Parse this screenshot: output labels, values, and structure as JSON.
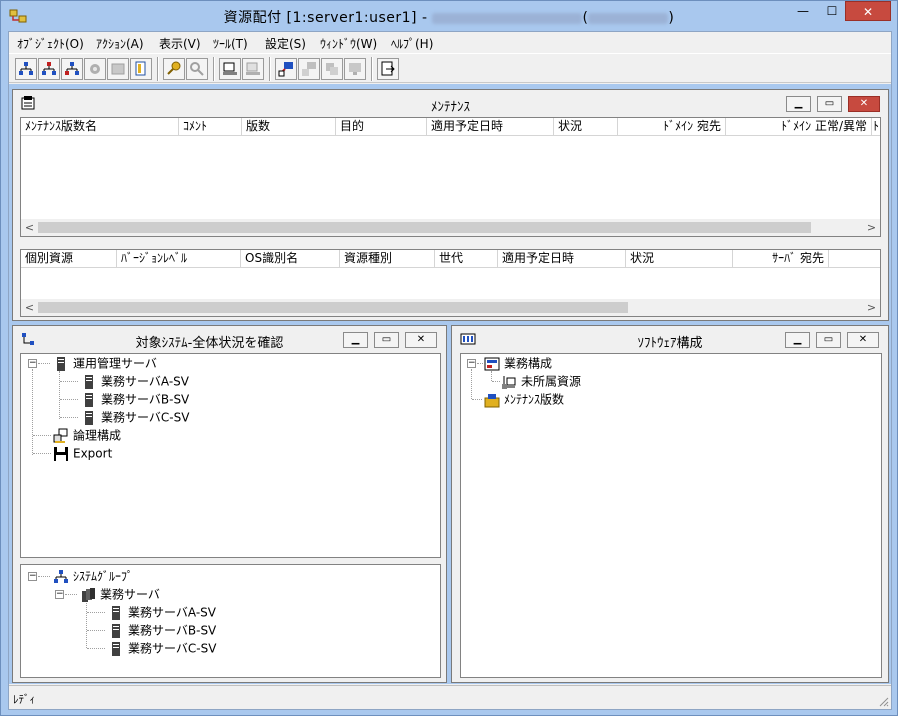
{
  "window": {
    "title_prefix": "資源配付 [1:server1:user1] - ",
    "title_redacted_open": "(",
    "title_redacted_close": ")",
    "caption_min": "—",
    "caption_max": "☐",
    "caption_close": "✕"
  },
  "menu": [
    {
      "label": "ｵﾌﾞｼﾞｪｸﾄ(O)"
    },
    {
      "label": "ｱｸｼｮﾝ(A)"
    },
    {
      "label": "表示(V)"
    },
    {
      "label": "ﾂｰﾙ(T)"
    },
    {
      "label": "設定(S)"
    },
    {
      "label": "ｳｨﾝﾄﾞｳ(W)"
    },
    {
      "label": "ﾍﾙﾌﾟ(H)"
    }
  ],
  "maintenance": {
    "title": "ﾒﾝﾃﾅﾝｽ",
    "columns": [
      "ﾒﾝﾃﾅﾝｽ版数名",
      "ｺﾒﾝﾄ",
      "版数",
      "目的",
      "適用予定日時",
      "状況",
      "ﾄﾞﾒｲﾝ 宛先",
      "ﾄﾞﾒｲﾝ 正常/異常",
      "ﾄ"
    ],
    "columns2": [
      "個別資源",
      "ﾊﾞｰｼﾞｮﾝﾚﾍﾞﾙ",
      "OS識別名",
      "資源種別",
      "世代",
      "適用予定日時",
      "状況",
      "ｻｰﾊﾞ 宛先"
    ]
  },
  "system_panel": {
    "title": "対象ｼｽﾃﾑ-全体状況を確認",
    "tree1": [
      {
        "label": "運用管理サーバ"
      },
      {
        "label": "業務サーバA-SV"
      },
      {
        "label": "業務サーバB-SV"
      },
      {
        "label": "業務サーバC-SV"
      },
      {
        "label": "論理構成"
      },
      {
        "label": "Export"
      }
    ],
    "tree2": [
      {
        "label": "ｼｽﾃﾑｸﾞﾙｰﾌﾟ"
      },
      {
        "label": "業務サーバ"
      },
      {
        "label": "業務サーバA-SV"
      },
      {
        "label": "業務サーバB-SV"
      },
      {
        "label": "業務サーバC-SV"
      }
    ]
  },
  "software_panel": {
    "title": "ｿﾌﾄｳｪｱ構成",
    "tree": [
      {
        "label": "業務構成"
      },
      {
        "label": "未所属資源"
      },
      {
        "label": "ﾒﾝﾃﾅﾝｽ版数"
      }
    ]
  },
  "status": {
    "text": "ﾚﾃﾞｨ"
  },
  "colors": {
    "frame": "#a9c8ee",
    "close_red": "#c74a3f",
    "face": "#f0f0f0"
  }
}
